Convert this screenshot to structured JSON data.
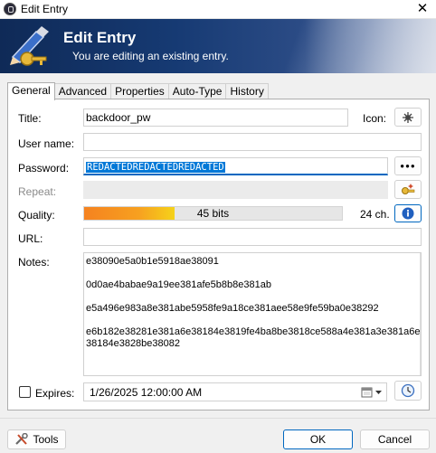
{
  "window": {
    "title": "Edit Entry",
    "close_glyph": "✕"
  },
  "banner": {
    "heading": "Edit Entry",
    "subtitle": "You are editing an existing entry."
  },
  "tabs": [
    {
      "label": "General",
      "active": true
    },
    {
      "label": "Advanced"
    },
    {
      "label": "Properties"
    },
    {
      "label": "Auto-Type"
    },
    {
      "label": "History"
    }
  ],
  "form": {
    "title_label": "Title:",
    "title_value": "backdoor_pw",
    "icon_label": "Icon:",
    "username_label": "User name:",
    "username_value": "",
    "password_label": "Password:",
    "password_value": "REDACTEDREDACTEDREDACTED",
    "password_dots": "●●●",
    "repeat_label": "Repeat:",
    "quality_label": "Quality:",
    "quality_text": "45 bits",
    "quality_fraction": 0.35,
    "quality_chars": "24 ch.",
    "url_label": "URL:",
    "url_value": "",
    "notes_label": "Notes:",
    "notes_lines": [
      "e38090e5a0b1e5918ae38091",
      "0d0ae4babae9a19ee381afe5b8b8e381ab",
      "e5a496e983a8e381abe5958fe9a18ce381aee58e9fe59ba0e38292",
      "e6b182e38281e381a6e38184e3819fe4ba8be3818ce588a4e381a3e381a6e38184e3828be38082"
    ],
    "expires_label": "Expires:",
    "expires_value": "1/26/2025 12:00:00 AM"
  },
  "footer": {
    "tools_label": "Tools",
    "ok_label": "OK",
    "cancel_label": "Cancel"
  },
  "colors": {
    "accent": "#0067c0",
    "selection": "#0078d7",
    "banner": "#163a73"
  }
}
